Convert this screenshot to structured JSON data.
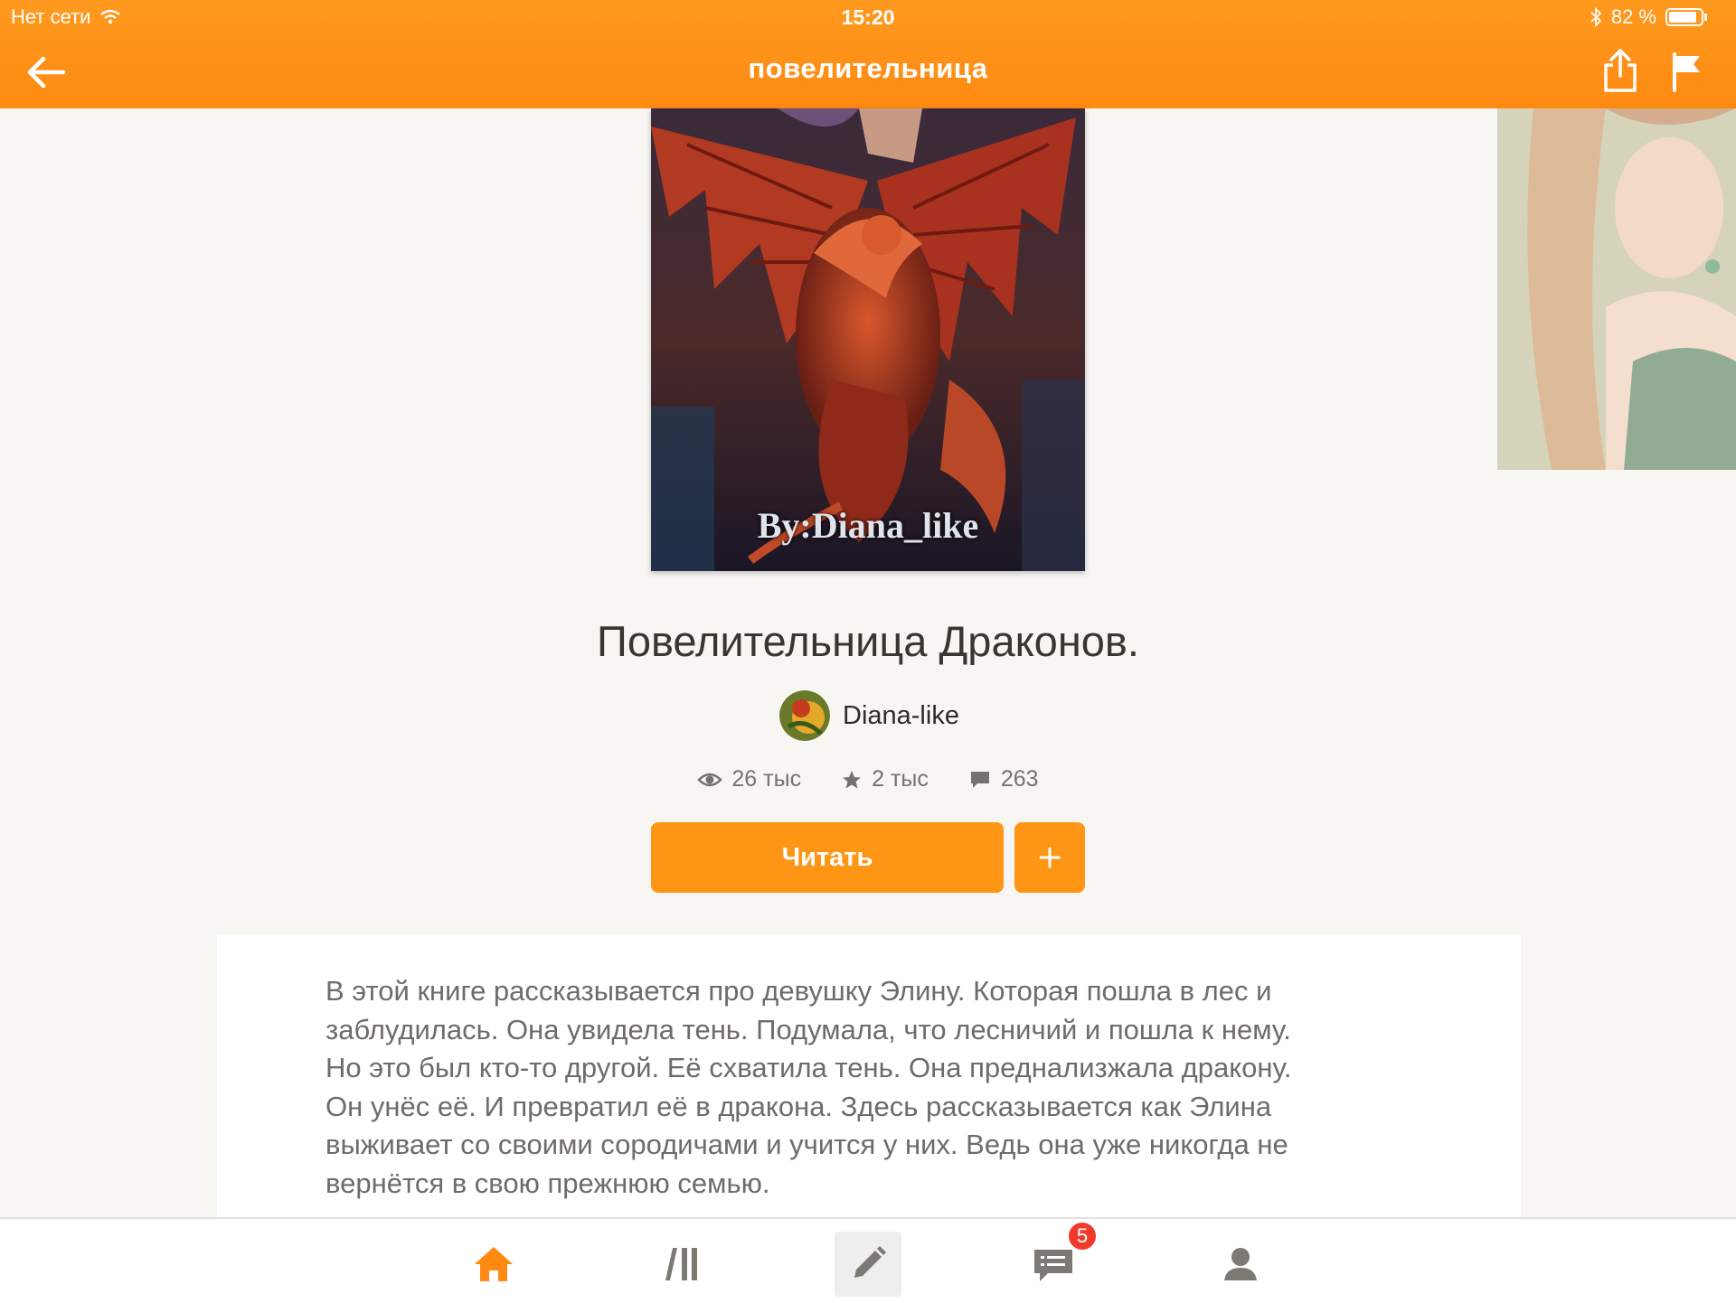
{
  "status_bar": {
    "network": "Нет сети",
    "time": "15:20",
    "battery": "82 %"
  },
  "nav": {
    "title": "повелительница"
  },
  "cover": {
    "overlay_text": "By:Diana_like"
  },
  "book": {
    "title": "Повелительница Драконов.",
    "author": "Diana-like",
    "stats": {
      "views": "26 тыс",
      "votes": "2 тыс",
      "comments": "263"
    },
    "read_label": "Читать",
    "add_label": "+"
  },
  "description": "В этой книге рассказывается про девушку Элину. Которая пошла в лес и\nзаблудилась. Она увидела тень. Подумала, что лесничий и пошла к нему.\nНо это был кто-то другой. Её схватила тень. Она преднализжала дракону.\nОн унёс  её.  И превратил её в дракона. Здесь рассказывается как Элина\nвыживает со своими сородичами и учится у них. Ведь она уже никогда не\nвернётся в свою прежнюю семью.",
  "tabbar": {
    "messages_badge": "5",
    "active_color": "#ff8a12",
    "inactive_color": "#7c7874"
  },
  "colors": {
    "accent": "#ff9515",
    "header": "#ff8a12"
  }
}
